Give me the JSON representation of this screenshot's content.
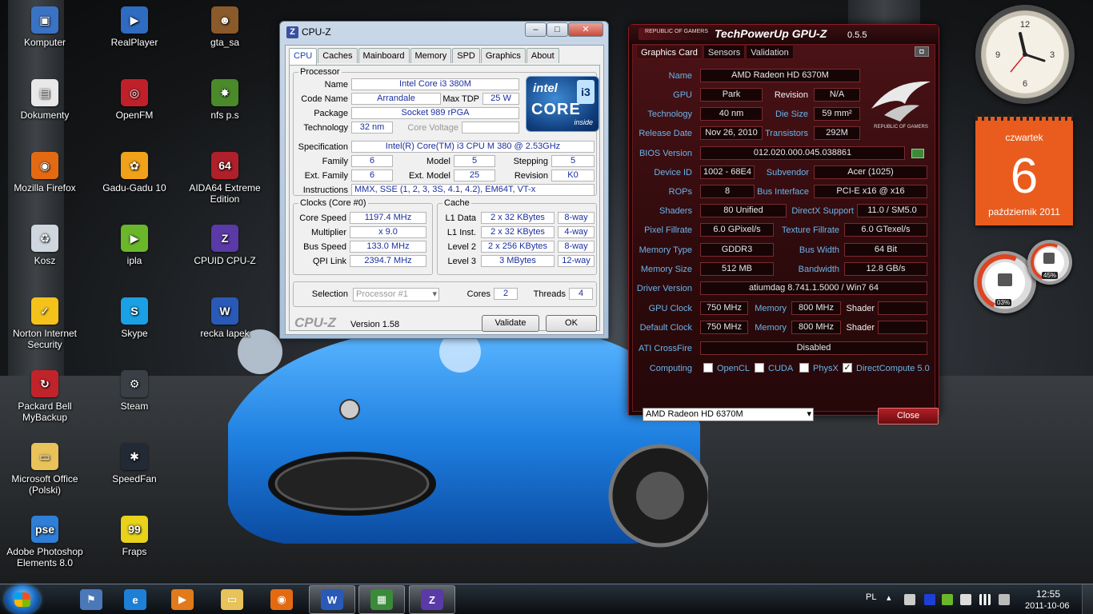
{
  "desktop": {
    "icons": [
      {
        "label": "Komputer",
        "icon": "computer-icon",
        "color": "#3b73c4",
        "glyph": "▣"
      },
      {
        "label": "Dokumenty",
        "icon": "documents-icon",
        "color": "#e8e8e8",
        "glyph": "▤"
      },
      {
        "label": "Mozilla Firefox",
        "icon": "firefox-icon",
        "color": "#e46a12",
        "glyph": "◉"
      },
      {
        "label": "Kosz",
        "icon": "recycle-bin-icon",
        "color": "#cfd6de",
        "glyph": "♻"
      },
      {
        "label": "Norton Internet Security",
        "icon": "norton-icon",
        "color": "#f4c21a",
        "glyph": "✓"
      },
      {
        "label": "Packard Bell MyBackup",
        "icon": "backup-icon",
        "color": "#c0242a",
        "glyph": "↻"
      },
      {
        "label": "Microsoft Office (Polski)",
        "icon": "folder-icon",
        "color": "#e9c25a",
        "glyph": "▭"
      },
      {
        "label": "Adobe Photoshop Elements 8.0",
        "icon": "photoshop-icon",
        "color": "#2f7fd6",
        "glyph": "pse"
      },
      {
        "label": "RealPlayer",
        "icon": "realplayer-icon",
        "color": "#2f6bc1",
        "glyph": "▶"
      },
      {
        "label": "OpenFM",
        "icon": "openfm-icon",
        "color": "#c0202a",
        "glyph": "◎"
      },
      {
        "label": "Gadu-Gadu 10",
        "icon": "gadugadu-icon",
        "color": "#f0a21a",
        "glyph": "✿"
      },
      {
        "label": "ipla",
        "icon": "ipla-icon",
        "color": "#6ab82a",
        "glyph": "▶"
      },
      {
        "label": "Skype",
        "icon": "skype-icon",
        "color": "#1aa0e4",
        "glyph": "S"
      },
      {
        "label": "Steam",
        "icon": "steam-icon",
        "color": "#3a3f45",
        "glyph": "⚙"
      },
      {
        "label": "SpeedFan",
        "icon": "speedfan-icon",
        "color": "#222a36",
        "glyph": "✱"
      },
      {
        "label": "Fraps",
        "icon": "fraps-icon",
        "color": "#e8d21a",
        "glyph": "99"
      },
      {
        "label": "gta_sa",
        "icon": "gta-icon",
        "color": "#8a5a2a",
        "glyph": "☻"
      },
      {
        "label": "nfs p.s",
        "icon": "nfs-icon",
        "color": "#4a8a2a",
        "glyph": "✸"
      },
      {
        "label": "AIDA64 Extreme Edition",
        "icon": "aida64-icon",
        "color": "#b0202a",
        "glyph": "64"
      },
      {
        "label": "CPUID CPU-Z",
        "icon": "cpuz-icon",
        "color": "#5a3aa6",
        "glyph": "Z"
      },
      {
        "label": "recka lapek",
        "icon": "word-document-icon",
        "color": "#2a5ab8",
        "glyph": "W"
      }
    ]
  },
  "cpuz": {
    "title": "CPU-Z",
    "title_logo": "Z",
    "tabs": [
      "CPU",
      "Caches",
      "Mainboard",
      "Memory",
      "SPD",
      "Graphics",
      "About"
    ],
    "processor": {
      "group": "Processor",
      "name_label": "Name",
      "name": "Intel Core i3 380M",
      "codename_label": "Code Name",
      "codename": "Arrandale",
      "maxtdp_label": "Max TDP",
      "maxtdp": "25 W",
      "package_label": "Package",
      "package": "Socket 989 rPGA",
      "technology_label": "Technology",
      "technology": "32 nm",
      "corevoltage_label": "Core Voltage",
      "corevoltage": "",
      "spec_label": "Specification",
      "spec": "Intel(R) Core(TM) i3 CPU      M 380  @ 2.53GHz",
      "family_label": "Family",
      "family": "6",
      "model_label": "Model",
      "model": "5",
      "stepping_label": "Stepping",
      "stepping": "5",
      "extfamily_label": "Ext. Family",
      "extfamily": "6",
      "extmodel_label": "Ext. Model",
      "extmodel": "25",
      "revision_label": "Revision",
      "revision": "K0",
      "instructions_label": "Instructions",
      "instructions": "MMX, SSE (1, 2, 3, 3S, 4.1, 4.2), EM64T, VT-x"
    },
    "intel_logo": {
      "brand": "intel",
      "line": "CORE",
      "tier": "i3",
      "tag": "inside"
    },
    "clocks": {
      "group": "Clocks (Core #0)",
      "corespeed_label": "Core Speed",
      "corespeed": "1197.4 MHz",
      "multiplier_label": "Multiplier",
      "multiplier": "x 9.0",
      "busspeed_label": "Bus Speed",
      "busspeed": "133.0 MHz",
      "qpilink_label": "QPI Link",
      "qpilink": "2394.7 MHz"
    },
    "cache": {
      "group": "Cache",
      "l1d_label": "L1 Data",
      "l1d": "2 x 32 KBytes",
      "l1d_way": "8-way",
      "l1i_label": "L1 Inst.",
      "l1i": "2 x 32 KBytes",
      "l1i_way": "4-way",
      "l2_label": "Level 2",
      "l2": "2 x 256 KBytes",
      "l2_way": "8-way",
      "l3_label": "Level 3",
      "l3": "3 MBytes",
      "l3_way": "12-way"
    },
    "selection_label": "Selection",
    "selection": "Processor #1",
    "cores_label": "Cores",
    "cores": "2",
    "threads_label": "Threads",
    "threads": "4",
    "brand": "CPU-Z",
    "version": "Version 1.58",
    "validate": "Validate",
    "ok": "OK"
  },
  "gpuz": {
    "title": "TechPowerUp GPU-Z",
    "version": "0.5.5",
    "rog": "REPUBLIC OF GAMERS",
    "tabs": [
      "Graphics Card",
      "Sensors",
      "Validation"
    ],
    "rows": {
      "name_label": "Name",
      "name": "AMD Radeon HD 6370M",
      "gpu_label": "GPU",
      "gpu": "Park",
      "revision_label": "Revision",
      "revision": "N/A",
      "technology_label": "Technology",
      "technology": "40 nm",
      "diesize_label": "Die Size",
      "diesize": "59 mm²",
      "release_label": "Release Date",
      "release": "Nov 26, 2010",
      "transistors_label": "Transistors",
      "transistors": "292M",
      "bios_label": "BIOS Version",
      "bios": "012.020.000.045.038861",
      "deviceid_label": "Device ID",
      "deviceid": "1002 - 68E4",
      "subvendor_label": "Subvendor",
      "subvendor": "Acer (1025)",
      "rops_label": "ROPs",
      "rops": "8",
      "businterface_label": "Bus Interface",
      "businterface": "PCI-E x16 @ x16",
      "shaders_label": "Shaders",
      "shaders": "80 Unified",
      "directx_label": "DirectX Support",
      "directx": "11.0 / SM5.0",
      "pixelfill_label": "Pixel Fillrate",
      "pixelfill": "6.0 GPixel/s",
      "texfill_label": "Texture Fillrate",
      "texfill": "6.0 GTexel/s",
      "memtype_label": "Memory Type",
      "memtype": "GDDR3",
      "buswidth_label": "Bus Width",
      "buswidth": "64 Bit",
      "memsize_label": "Memory Size",
      "memsize": "512 MB",
      "bandwidth_label": "Bandwidth",
      "bandwidth": "12.8 GB/s",
      "driver_label": "Driver Version",
      "driver": "atiumdag 8.741.1.5000 / Win7 64",
      "gpuclock_label": "GPU Clock",
      "gpuclock": "750 MHz",
      "memclock_label": "Memory",
      "memclock": "800 MHz",
      "shader_label": "Shader",
      "shader": "",
      "defclock_label": "Default Clock",
      "defclock": "750 MHz",
      "defmem_label": "Memory",
      "defmem": "800 MHz",
      "defshader_label": "Shader",
      "defshader": "",
      "crossfire_label": "ATI CrossFire",
      "crossfire": "Disabled",
      "computing_label": "Computing",
      "opencl": "OpenCL",
      "cuda": "CUDA",
      "physx": "PhysX",
      "directcompute": "DirectCompute 5.0",
      "directcompute_check": "✓"
    },
    "select": "AMD Radeon HD 6370M",
    "close": "Close"
  },
  "gadgets": {
    "calendar": {
      "weekday": "czwartek",
      "day": "6",
      "month": "październik 2011",
      "color": "#e95c1e"
    },
    "meters": {
      "cpu": "03%",
      "ram": "45%"
    }
  },
  "taskbar": {
    "apps": [
      {
        "icon": "user-icon",
        "color": "#4a78b8",
        "glyph": "⚑",
        "open": false
      },
      {
        "icon": "internet-explorer-icon",
        "color": "#1e7fd6",
        "glyph": "e",
        "open": false
      },
      {
        "icon": "media-player-icon",
        "color": "#e07a1a",
        "glyph": "▶",
        "open": false
      },
      {
        "icon": "explorer-icon",
        "color": "#e8c25a",
        "glyph": "▭",
        "open": false
      },
      {
        "icon": "firefox-icon",
        "color": "#e46a12",
        "glyph": "◉",
        "open": false
      },
      {
        "icon": "word-icon",
        "color": "#2a5ab8",
        "glyph": "W",
        "open": true
      },
      {
        "icon": "gpuz-icon",
        "color": "#3a8a3a",
        "glyph": "▦",
        "open": true
      },
      {
        "icon": "cpuz-icon",
        "color": "#5a3aa6",
        "glyph": "Z",
        "open": true
      }
    ],
    "lang": "PL",
    "time": "12:55",
    "date": "2011-10-06"
  }
}
